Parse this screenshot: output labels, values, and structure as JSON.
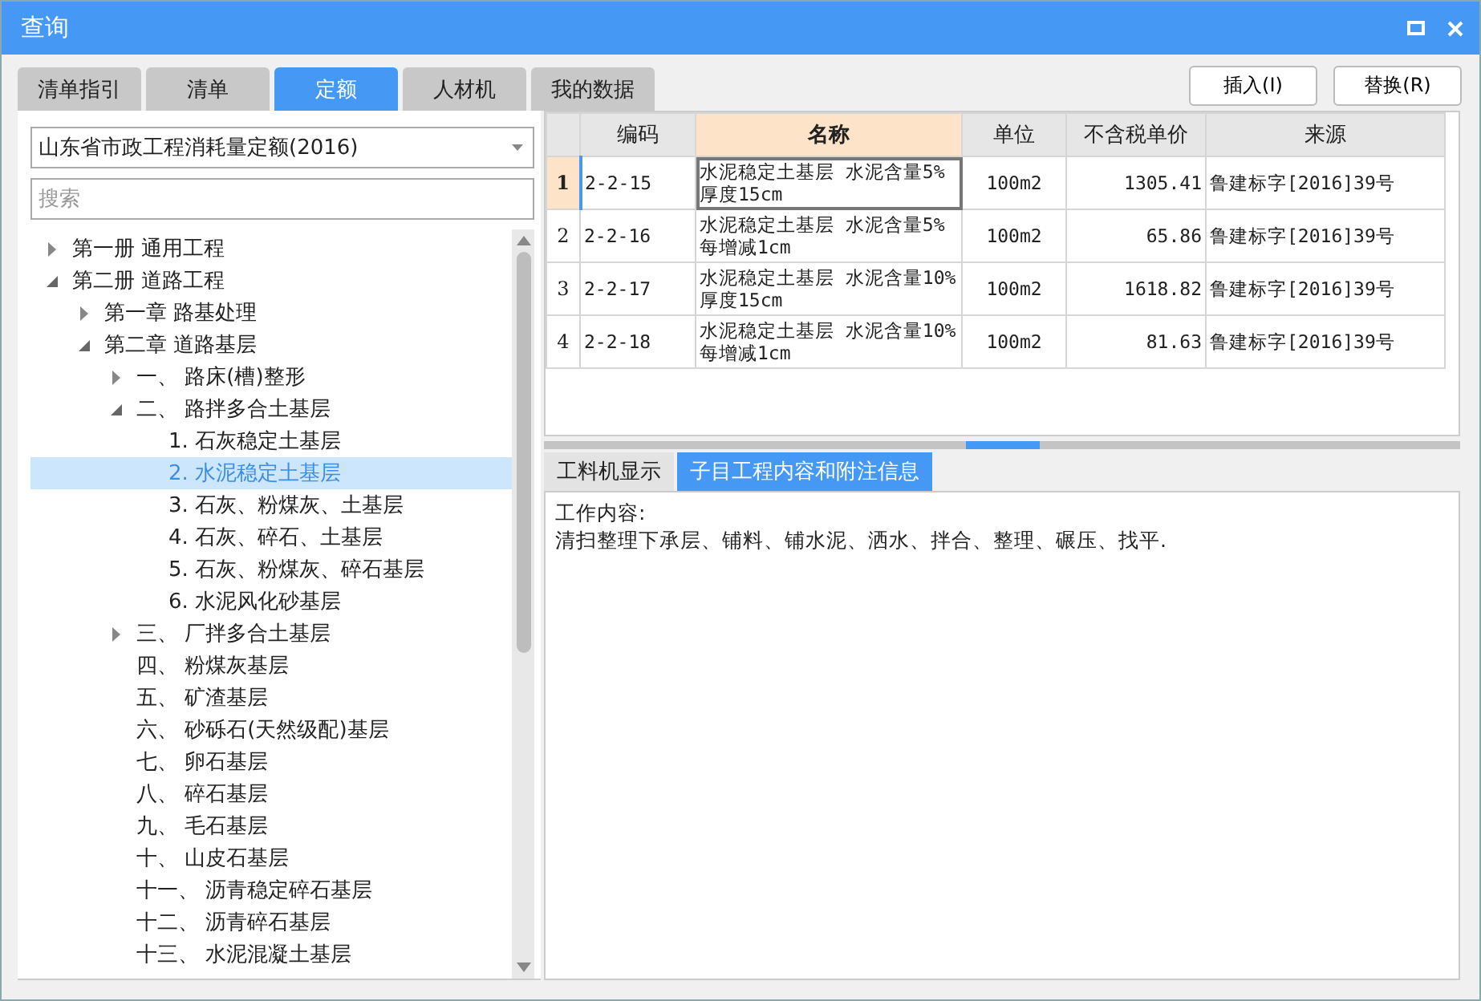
{
  "window": {
    "title": "查询"
  },
  "tabs": [
    {
      "label": "清单指引",
      "selected": false
    },
    {
      "label": "清单",
      "selected": false
    },
    {
      "label": "定额",
      "selected": true
    },
    {
      "label": "人材机",
      "selected": false
    },
    {
      "label": "我的数据",
      "selected": false
    }
  ],
  "buttons": [
    "插入(I)",
    "替换(R)"
  ],
  "library_select": {
    "value": "山东省市政工程消耗量定额(2016)"
  },
  "search": {
    "placeholder": "搜索"
  },
  "tree": [
    {
      "label": "第一册 通用工程",
      "expanded": false,
      "selected": false
    },
    {
      "label": "第二册 道路工程",
      "expanded": true,
      "selected": false,
      "children": [
        {
          "label": "第一章 路基处理",
          "expanded": false,
          "selected": false
        },
        {
          "label": "第二章 道路基层",
          "expanded": true,
          "selected": false,
          "children": [
            {
              "label": "一、 路床(槽)整形",
              "expanded": false,
              "selected": false
            },
            {
              "label": "二、 路拌多合土基层",
              "expanded": true,
              "selected": false,
              "children": [
                {
                  "label": "1. 石灰稳定土基层",
                  "selected": false
                },
                {
                  "label": "2. 水泥稳定土基层",
                  "selected": true
                },
                {
                  "label": "3. 石灰、粉煤灰、土基层",
                  "selected": false
                },
                {
                  "label": "4. 石灰、碎石、土基层",
                  "selected": false
                },
                {
                  "label": "5. 石灰、粉煤灰、碎石基层",
                  "selected": false
                },
                {
                  "label": "6. 水泥风化砂基层",
                  "selected": false
                }
              ]
            },
            {
              "label": "三、 厂拌多合土基层",
              "expanded": false,
              "selected": false
            },
            {
              "label": "四、 粉煤灰基层",
              "selected": false
            },
            {
              "label": "五、 矿渣基层",
              "selected": false
            },
            {
              "label": "六、 砂砾石(天然级配)基层",
              "selected": false
            },
            {
              "label": "七、 卵石基层",
              "selected": false
            },
            {
              "label": "八、 碎石基层",
              "selected": false
            },
            {
              "label": "九、 毛石基层",
              "selected": false
            },
            {
              "label": "十、 山皮石基层",
              "selected": false
            },
            {
              "label": "十一、 沥青稳定碎石基层",
              "selected": false
            },
            {
              "label": "十二、 沥青碎石基层",
              "selected": false
            },
            {
              "label": "十三、 水泥混凝土基层",
              "selected": false
            }
          ]
        }
      ]
    }
  ],
  "table": {
    "columns": [
      {
        "label": "编码",
        "selected": false
      },
      {
        "label": "名称",
        "selected": true
      },
      {
        "label": "单位",
        "selected": false
      },
      {
        "label": "不含税单价",
        "selected": false
      },
      {
        "label": "来源",
        "selected": false
      }
    ],
    "rows": [
      {
        "number": "1",
        "selected": true,
        "cells": [
          "2-2-15",
          "水泥稳定土基层 水泥含量5% 厚度15cm",
          "100m2",
          "1305.41",
          "鲁建标字[2016]39号"
        ]
      },
      {
        "number": "2",
        "selected": false,
        "cells": [
          "2-2-16",
          "水泥稳定土基层 水泥含量5% 每增减1cm",
          "100m2",
          "65.86",
          "鲁建标字[2016]39号"
        ]
      },
      {
        "number": "3",
        "selected": false,
        "cells": [
          "2-2-17",
          "水泥稳定土基层 水泥含量10% 厚度15cm",
          "100m2",
          "1618.82",
          "鲁建标字[2016]39号"
        ]
      },
      {
        "number": "4",
        "selected": false,
        "cells": [
          "2-2-18",
          "水泥稳定土基层 水泥含量10% 每增减1cm",
          "100m2",
          "81.63",
          "鲁建标字[2016]39号"
        ]
      }
    ]
  },
  "detail_tabs": [
    {
      "label": "工料机显示",
      "selected": false
    },
    {
      "label": "子目工程内容和附注信息",
      "selected": true
    }
  ],
  "detail": {
    "heading": "工作内容:",
    "text": "清扫整理下承层、铺料、铺水泥、洒水、拌合、整理、碾压、找平."
  }
}
